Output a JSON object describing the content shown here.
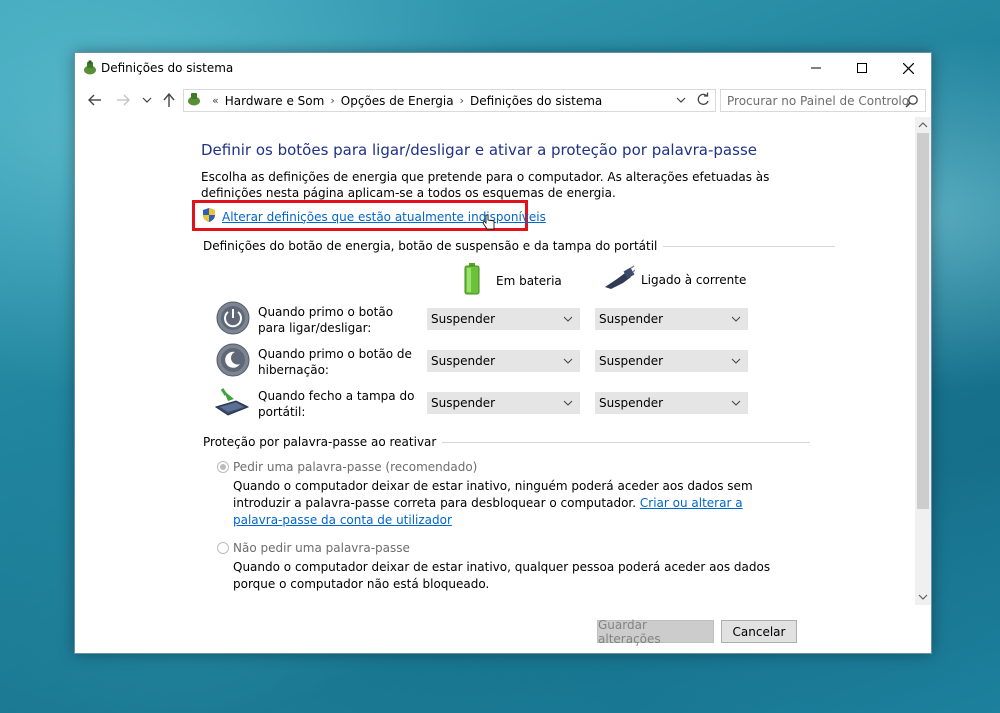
{
  "window": {
    "title": "Definições do sistema",
    "controls": {
      "minimize": "minimize-icon",
      "maximize": "maximize-icon",
      "close": "close-icon"
    }
  },
  "nav": {
    "breadcrumb_separator": "«",
    "breadcrumbs": [
      "Hardware e Som",
      "Opções de Energia",
      "Definições do sistema"
    ],
    "search_placeholder": "Procurar no Painel de Controlo"
  },
  "main": {
    "heading": "Definir os botões para ligar/desligar e ativar a proteção por palavra-passe",
    "description": "Escolha as definições de energia que pretende para o computador. As alterações efetuadas às definições nesta página aplicam-se a todos os esquemas de energia.",
    "change_link": "Alterar definições que estão atualmente indisponíveis",
    "section_power": "Definições do botão de energia, botão de suspensão e da tampa do portátil",
    "col_battery": "Em bateria",
    "col_plugged": "Ligado à corrente",
    "rows": [
      {
        "label": "Quando primo o botão para ligar/desligar:",
        "battery": "Suspender",
        "plugged": "Suspender"
      },
      {
        "label": "Quando primo o botão de hibernação:",
        "battery": "Suspender",
        "plugged": "Suspender"
      },
      {
        "label": "Quando fecho a tampa do portátil:",
        "battery": "Suspender",
        "plugged": "Suspender"
      }
    ],
    "section_password": "Proteção por palavra-passe ao reativar",
    "radio_require": {
      "label": "Pedir uma palavra-passe (recomendado)",
      "desc": "Quando o computador deixar de estar inativo, ninguém poderá aceder aos dados sem introduzir a palavra-passe correta para desbloquear o computador. ",
      "link": "Criar ou alterar a palavra-passe da conta de utilizador",
      "selected": true
    },
    "radio_none": {
      "label": "Não pedir uma palavra-passe",
      "desc": "Quando o computador deixar de estar inativo, qualquer pessoa poderá aceder aos dados porque o computador não está bloqueado.",
      "selected": false
    }
  },
  "footer": {
    "save": "Guardar alterações",
    "cancel": "Cancelar"
  },
  "colors": {
    "highlight": "#e3111b",
    "heading": "#1e3287",
    "link": "#0066cc"
  }
}
